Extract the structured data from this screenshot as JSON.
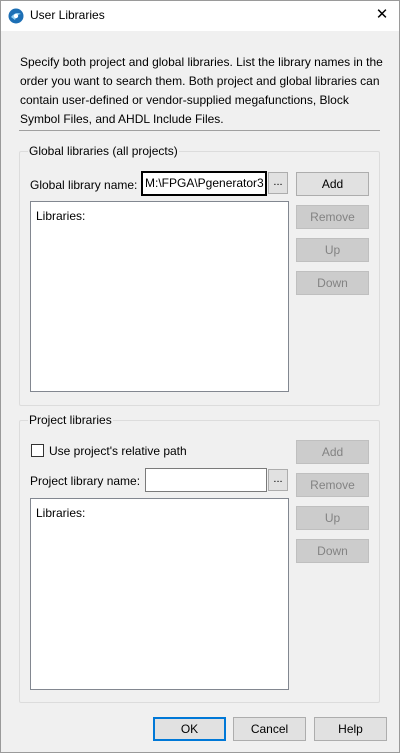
{
  "window": {
    "title": "User Libraries",
    "close_glyph": "✕"
  },
  "description": "Specify both project and global libraries. List the library names in the order you want to search them. Both project and global libraries can contain user-defined or vendor-supplied megafunctions, Block Symbol Files, and AHDL Include Files.",
  "global": {
    "group_title": "Global libraries (all projects)",
    "name_label": "Global library name:",
    "name_value": "M:\\FPGA\\Pgenerator3",
    "browse_label": "...",
    "list_header": "Libraries:",
    "buttons": {
      "add": "Add",
      "remove": "Remove",
      "up": "Up",
      "down": "Down"
    }
  },
  "project": {
    "group_title": "Project libraries",
    "relative_path_label": "Use project's relative path",
    "relative_path_checked": false,
    "name_label": "Project library name:",
    "name_value": "",
    "browse_label": "...",
    "list_header": "Libraries:",
    "buttons": {
      "add": "Add",
      "remove": "Remove",
      "up": "Up",
      "down": "Down"
    }
  },
  "footer": {
    "ok": "OK",
    "cancel": "Cancel",
    "help": "Help"
  },
  "colors": {
    "accent": "#0078d7",
    "disabled_text": "#838383",
    "disabled_bg": "#cccccc"
  }
}
